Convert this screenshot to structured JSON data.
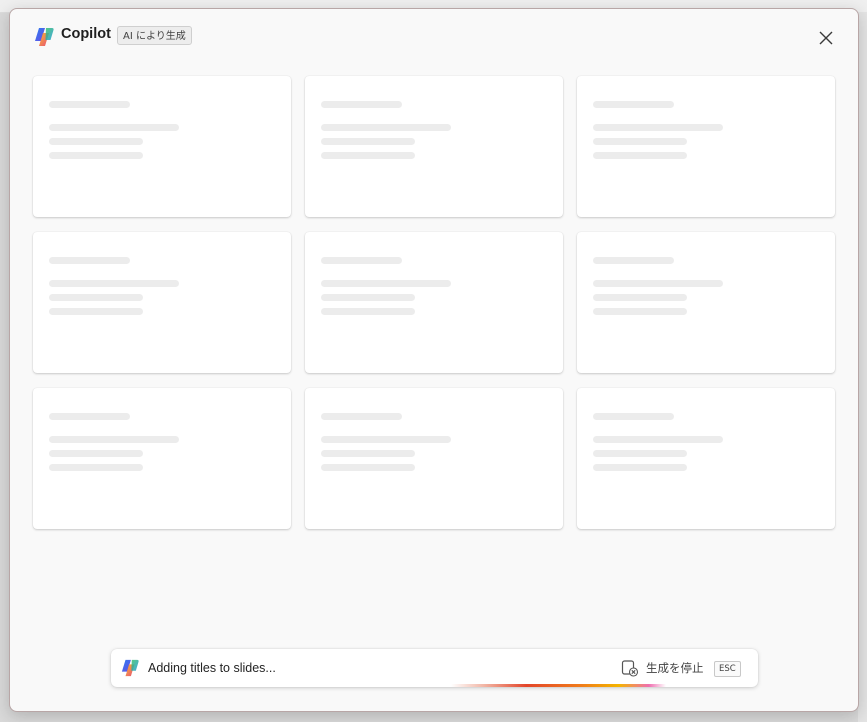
{
  "dialog": {
    "title": "Copilot",
    "ai_badge": "AI により生成",
    "close_icon": "close-icon"
  },
  "cards": [
    {
      "state": "loading"
    },
    {
      "state": "loading"
    },
    {
      "state": "loading"
    },
    {
      "state": "loading"
    },
    {
      "state": "loading"
    },
    {
      "state": "loading"
    },
    {
      "state": "loading"
    },
    {
      "state": "loading"
    },
    {
      "state": "loading"
    }
  ],
  "status": {
    "message": "Adding titles to slides...",
    "stop_label": "生成を停止",
    "esc_key": "ESC",
    "stop_icon": "stop-generating-icon"
  },
  "colors": {
    "dialog_bg": "#f9f9f9",
    "skeleton": "#ececec",
    "progress_gradient": [
      "#e3462a",
      "#f07b1b",
      "#f4b400",
      "#ef6fb0"
    ]
  }
}
